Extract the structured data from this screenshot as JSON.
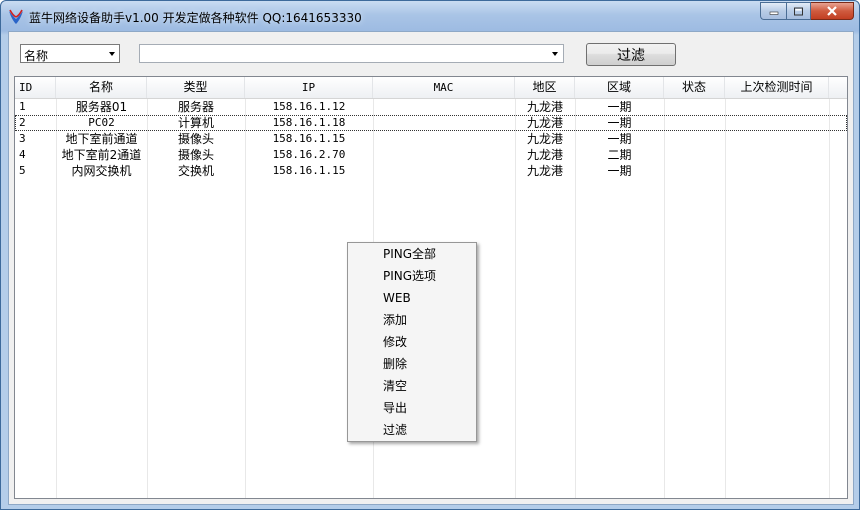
{
  "window": {
    "title": "蓝牛网络设备助手v1.00   开发定做各种软件 QQ:1641653330"
  },
  "toolbar": {
    "field_select": "名称",
    "search_value": "",
    "filter_label": "过滤"
  },
  "table": {
    "columns": [
      "ID",
      "名称",
      "类型",
      "IP",
      "MAC",
      "地区",
      "区域",
      "状态",
      "上次检测时间"
    ],
    "rows": [
      [
        "1",
        "服务器01",
        "服务器",
        "158.16.1.12",
        "",
        "九龙港",
        "一期",
        "",
        ""
      ],
      [
        "2",
        "PC02",
        "计算机",
        "158.16.1.18",
        "",
        "九龙港",
        "一期",
        "",
        ""
      ],
      [
        "3",
        "地下室前通道",
        "摄像头",
        "158.16.1.15",
        "",
        "九龙港",
        "一期",
        "",
        ""
      ],
      [
        "4",
        "地下室前2通道",
        "摄像头",
        "158.16.2.70",
        "",
        "九龙港",
        "二期",
        "",
        ""
      ],
      [
        "5",
        "内网交换机",
        "交换机",
        "158.16.1.15",
        "",
        "九龙港",
        "一期",
        "",
        ""
      ]
    ]
  },
  "context_menu": {
    "items": [
      "PING全部",
      "PING选项",
      "WEB",
      "添加",
      "修改",
      "删除",
      "清空",
      "导出",
      "过滤"
    ]
  },
  "colors": {
    "titlebar": "#a9c4e6",
    "close_button": "#c94a30",
    "client_bg": "#f0f0f0"
  }
}
